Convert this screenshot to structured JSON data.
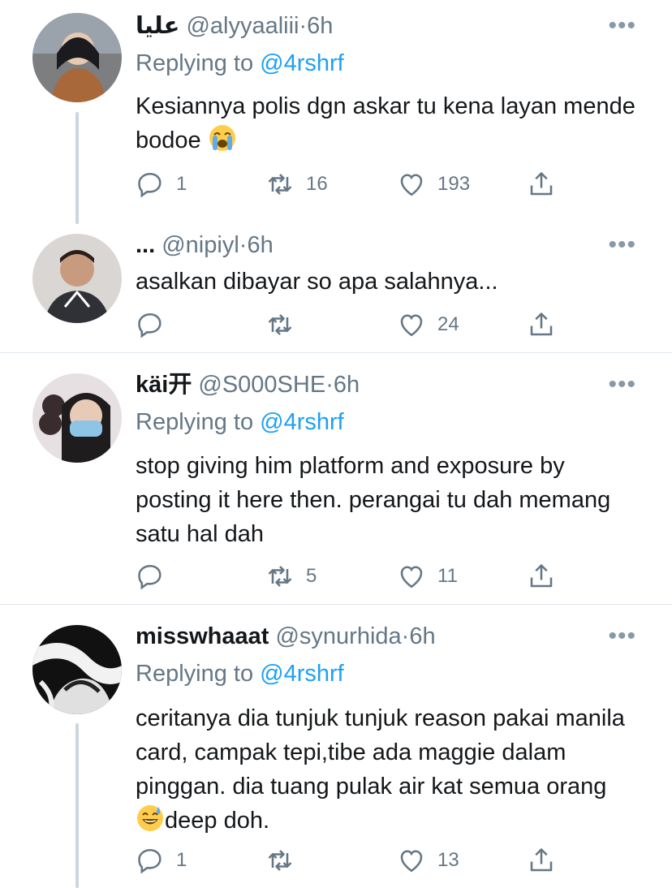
{
  "tweets": [
    {
      "name": "عليا",
      "handle": "@alyyaaliii",
      "dot": "·",
      "time": "6h",
      "replying_prefix": "Replying to ",
      "replying_to": "@4rshrf",
      "text": "Kesiannya polis dgn askar tu kena layan mende bodoe",
      "emoji": "loudly-crying-face",
      "replies": "1",
      "retweets": "16",
      "likes": "193"
    },
    {
      "name": "...",
      "handle": "@nipiyl",
      "dot": "·",
      "time": "6h",
      "text": "asalkan dibayar so apa salahnya...",
      "replies": "",
      "retweets": "",
      "likes": "24"
    },
    {
      "name": "käi开",
      "handle": "@S000SHE",
      "dot": "·",
      "time": "6h",
      "replying_prefix": "Replying to ",
      "replying_to": "@4rshrf",
      "text": "stop giving him platform and exposure by posting it here then. perangai tu dah memang satu hal dah",
      "replies": "",
      "retweets": "5",
      "likes": "11"
    },
    {
      "name": "misswhaaat",
      "handle": "@synurhida",
      "dot": "·",
      "time": "6h",
      "replying_prefix": "Replying to ",
      "replying_to": "@4rshrf",
      "text_before_emoji": "ceritanya dia tunjuk tunjuk reason pakai manila card, campak tepi,tibe ada maggie dalam pinggan. dia tuang pulak air kat semua orang ",
      "text_after_emoji": "deep doh.",
      "emoji": "grinning-face-with-sweat",
      "replies": "1",
      "retweets": "",
      "likes": "13"
    }
  ],
  "more_glyph": "•••",
  "colors": {
    "link": "#1da1f2",
    "secondary": "#657786",
    "text": "#14171a",
    "divider": "#e1e8ed",
    "thread": "#ccd6dd"
  }
}
